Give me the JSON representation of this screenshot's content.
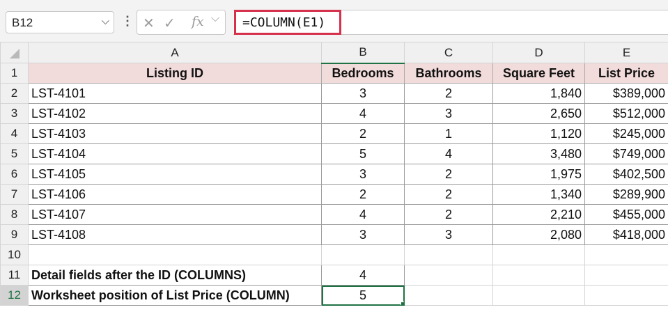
{
  "name_box": {
    "value": "B12",
    "dropdown_icon": "chevron-down-icon"
  },
  "formula_bar": {
    "cancel_icon": "✕",
    "enter_icon": "✓",
    "fx_label": "fx",
    "formula_chevron": "⌵",
    "formula": "=COLUMN(E1)"
  },
  "columns": [
    "A",
    "B",
    "C",
    "D",
    "E"
  ],
  "headers": [
    "Listing ID",
    "Bedrooms",
    "Bathrooms",
    "Square Feet",
    "List Price"
  ],
  "rows": [
    {
      "id": "LST-4101",
      "beds": "3",
      "baths": "2",
      "sqft": "1,840",
      "price": "$389,000"
    },
    {
      "id": "LST-4102",
      "beds": "4",
      "baths": "3",
      "sqft": "2,650",
      "price": "$512,000"
    },
    {
      "id": "LST-4103",
      "beds": "2",
      "baths": "1",
      "sqft": "1,120",
      "price": "$245,000"
    },
    {
      "id": "LST-4104",
      "beds": "5",
      "baths": "4",
      "sqft": "3,480",
      "price": "$749,000"
    },
    {
      "id": "LST-4105",
      "beds": "3",
      "baths": "2",
      "sqft": "1,975",
      "price": "$402,500"
    },
    {
      "id": "LST-4106",
      "beds": "2",
      "baths": "2",
      "sqft": "1,340",
      "price": "$289,900"
    },
    {
      "id": "LST-4107",
      "beds": "4",
      "baths": "2",
      "sqft": "2,210",
      "price": "$455,000"
    },
    {
      "id": "LST-4108",
      "beds": "3",
      "baths": "3",
      "sqft": "2,080",
      "price": "$418,000"
    }
  ],
  "row_numbers": [
    "1",
    "2",
    "3",
    "4",
    "5",
    "6",
    "7",
    "8",
    "9",
    "10",
    "11",
    "12"
  ],
  "summary": [
    {
      "label": "Detail fields after the ID (COLUMNS)",
      "value": "4"
    },
    {
      "label": "Worksheet position of List Price (COLUMN)",
      "value": "5"
    }
  ],
  "colors": {
    "header_fill": "#f2dcdb",
    "selection": "#1f7244",
    "formula_highlight": "#d6304d"
  }
}
